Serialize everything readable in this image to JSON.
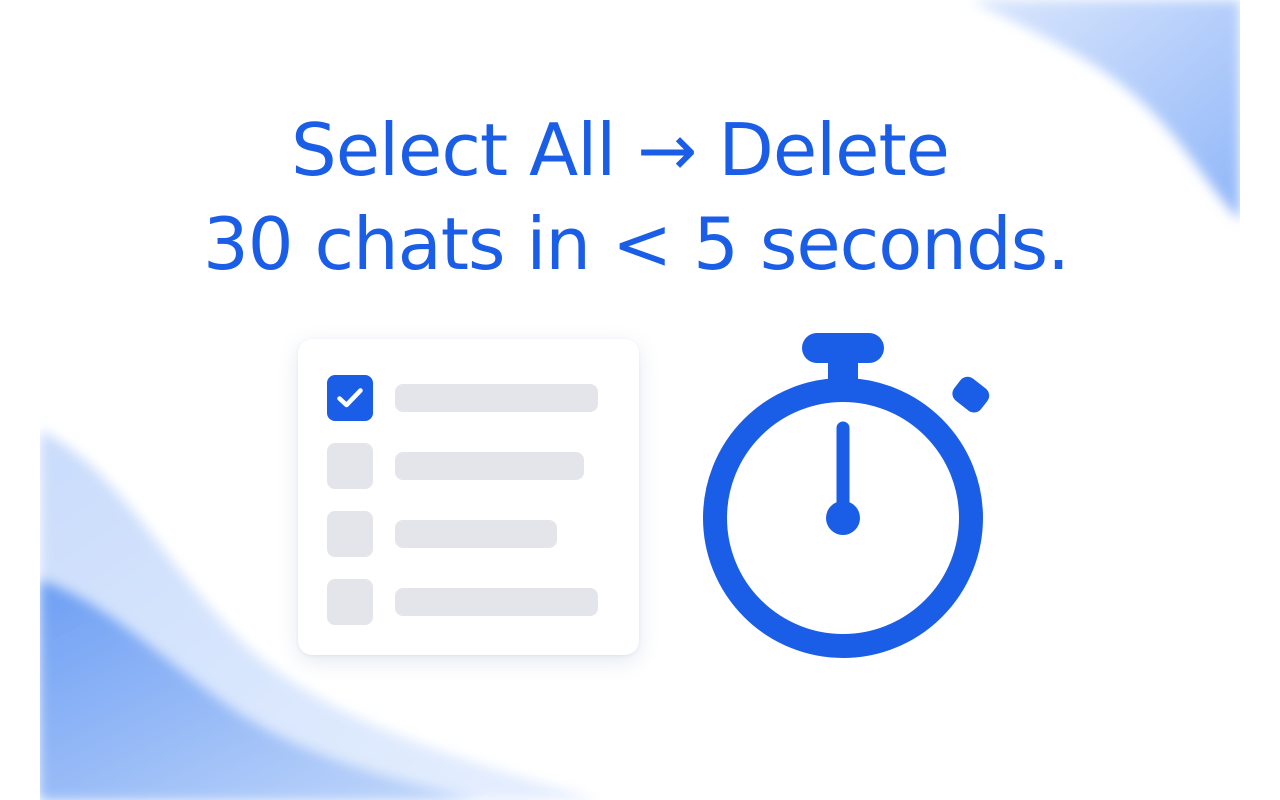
{
  "headline": {
    "line1": "Select All → Delete",
    "line2": "30 chats in < 5 seconds."
  },
  "list_card": {
    "rows": [
      {
        "checked": true
      },
      {
        "checked": false
      },
      {
        "checked": false
      },
      {
        "checked": false
      }
    ]
  },
  "icons": {
    "checkmark": "checkmark-icon",
    "stopwatch": "stopwatch-icon"
  },
  "colors": {
    "accent": "#1a5ee8",
    "placeholder_gray": "#e3e5ea",
    "wave_light": "#dbe7fd",
    "wave_mid": "#a9c7fb",
    "wave_dark": "#5f97f2"
  }
}
